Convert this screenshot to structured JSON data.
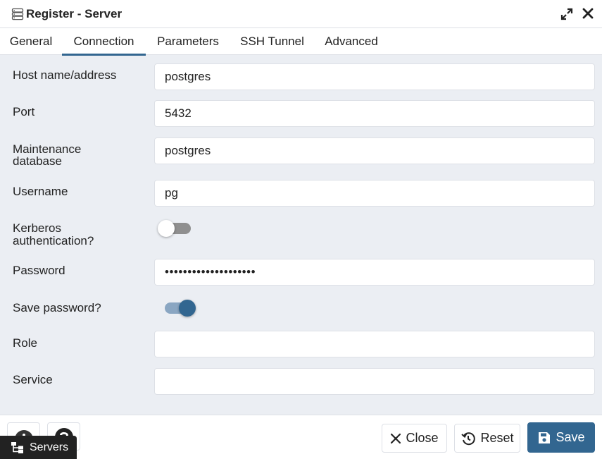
{
  "dialog": {
    "title": "Register - Server"
  },
  "tabs": [
    {
      "label": "General",
      "active": false
    },
    {
      "label": "Connection",
      "active": true
    },
    {
      "label": "Parameters",
      "active": false
    },
    {
      "label": "SSH Tunnel",
      "active": false
    },
    {
      "label": "Advanced",
      "active": false
    }
  ],
  "form": {
    "host": {
      "label": "Host name/address",
      "value": "postgres"
    },
    "port": {
      "label": "Port",
      "value": "5432"
    },
    "maintenance_db": {
      "label_line1": "Maintenance",
      "label_line2": "database",
      "value": "postgres"
    },
    "username": {
      "label": "Username",
      "value": "pg"
    },
    "kerberos": {
      "label_line1": "Kerberos",
      "label_line2": "authentication?",
      "enabled": false
    },
    "password": {
      "label": "Password",
      "value": "••••••••••••••••••••"
    },
    "save_password": {
      "label": "Save password?",
      "enabled": true
    },
    "role": {
      "label": "Role",
      "value": ""
    },
    "service": {
      "label": "Service",
      "value": ""
    }
  },
  "footer": {
    "close_label": "Close",
    "reset_label": "Reset",
    "save_label": "Save",
    "info_icon": "info-icon",
    "help_icon": "help-icon"
  },
  "taskbar": {
    "servers_label": "Servers"
  },
  "colors": {
    "accent": "#326690",
    "background": "#ebeef3",
    "border": "#dde0e6"
  }
}
